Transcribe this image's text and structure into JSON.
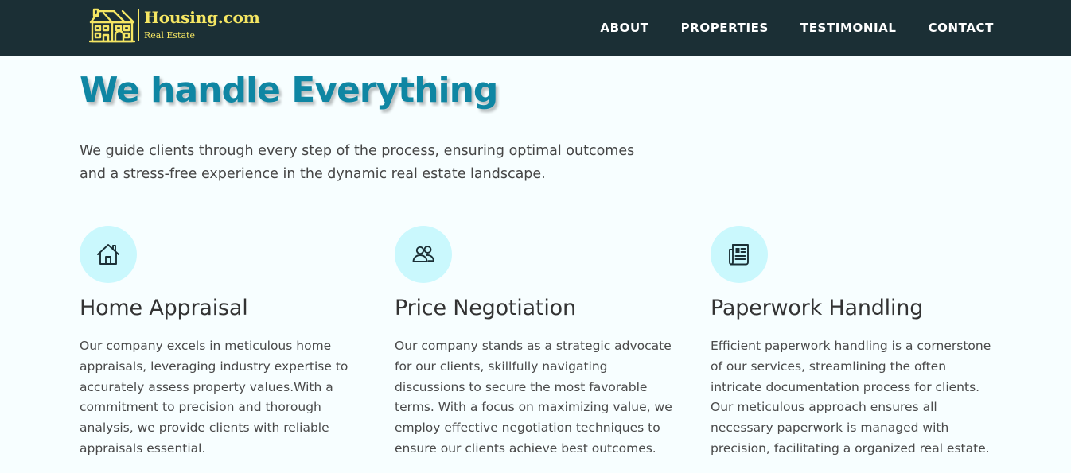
{
  "brand": {
    "name": "Housing.com",
    "tagline": "Real Estate"
  },
  "nav": {
    "items": [
      {
        "label": "ABOUT"
      },
      {
        "label": "PROPERTIES"
      },
      {
        "label": "TESTIMONIAL"
      },
      {
        "label": "CONTACT"
      }
    ]
  },
  "hero": {
    "title": "We handle Everything",
    "description": "We guide clients through every step of the process, ensuring optimal outcomes and a stress-free experience in the dynamic real estate landscape."
  },
  "features": [
    {
      "icon": "home-icon",
      "title": "Home Appraisal",
      "text": "Our company excels in meticulous home appraisals, leveraging industry expertise to accurately assess property values.With a commitment to precision and thorough analysis, we provide clients with reliable appraisals essential."
    },
    {
      "icon": "users-icon",
      "title": "Price Negotiation",
      "text": "Our company stands as a strategic advocate for our clients, skillfully navigating discussions to secure the most favorable terms. With a focus on maximizing value, we employ effective negotiation techniques to ensure our clients achieve best outcomes."
    },
    {
      "icon": "newspaper-icon",
      "title": "Paperwork Handling",
      "text": "Efficient paperwork handling is a cornerstone of our services, streamlining the often intricate documentation process for clients. Our meticulous approach ensures all necessary paperwork is managed with precision, facilitating a organized real estate."
    }
  ],
  "colors": {
    "navbar_bg": "#1b2f35",
    "brand_yellow": "#f5e663",
    "title_teal": "#0f86a3",
    "icon_circle_bg": "#caf8fd",
    "page_bg": "#f7feff"
  }
}
